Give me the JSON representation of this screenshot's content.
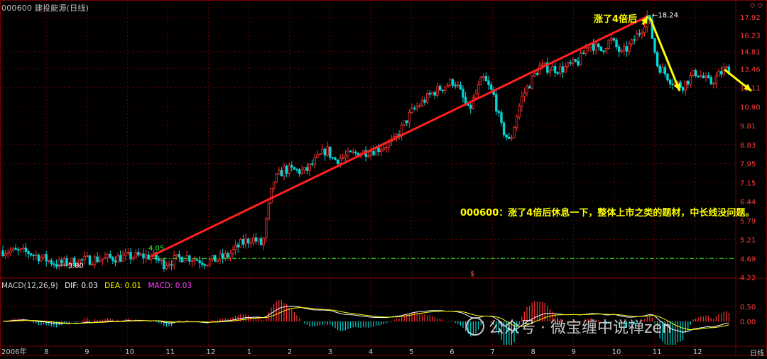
{
  "header": {
    "title": "000600 建投能源(日线)",
    "window_icons": "◇ ◇"
  },
  "annotations": {
    "peak_note": "涨了4倍后",
    "comment": "000600：涨了4倍后休息一下，整体上市之类的题材，中长线没问题。",
    "low_label": "3.80",
    "mid_label": "4.05",
    "high_label": "18.24",
    "dollar_mark": "$"
  },
  "macd": {
    "label": "MACD(12,26,9)",
    "dif_label": "DIF: 0.03",
    "dea_label": "DEA: 0.01",
    "macd_label": "MACD: 0.03",
    "ticks": [
      "0.50",
      "0.00"
    ]
  },
  "footer": {
    "period_label": "日线"
  },
  "watermark": {
    "text": "公众号 · 微宝缠中说禅zen",
    "icon": "wechat-icon"
  },
  "colors": {
    "up": "#ff3232",
    "down": "#00d8d8",
    "dif": "#ffffff",
    "dea": "#ffff00",
    "grid": "#7a0000",
    "trend": "#ff2020",
    "arrow": "#ffff00",
    "baseline": "#32ff32"
  },
  "chart_data": {
    "type": "candlestick",
    "y_scale": "log",
    "ylim": [
      4.55,
      18.8
    ],
    "y_ticks": [
      "17.92",
      "16.23",
      "14.81",
      "13.46",
      "12.11",
      "10.90",
      "9.81",
      "8.83",
      "7.95",
      "7.15",
      "6.44",
      "5.79",
      "5.21",
      "4.69",
      "4.22"
    ],
    "x_labels": [
      "2006年",
      "8",
      "9",
      "10",
      "11",
      "12",
      "1",
      "2",
      "3",
      "4",
      "5",
      "6",
      "7",
      "8",
      "9",
      "10",
      "11",
      "12"
    ],
    "key_prices": {
      "low": 3.8,
      "mid": 4.05,
      "high": 18.24
    },
    "series": [
      {
        "name": "MACD",
        "values": [
          0.03
        ]
      }
    ]
  }
}
